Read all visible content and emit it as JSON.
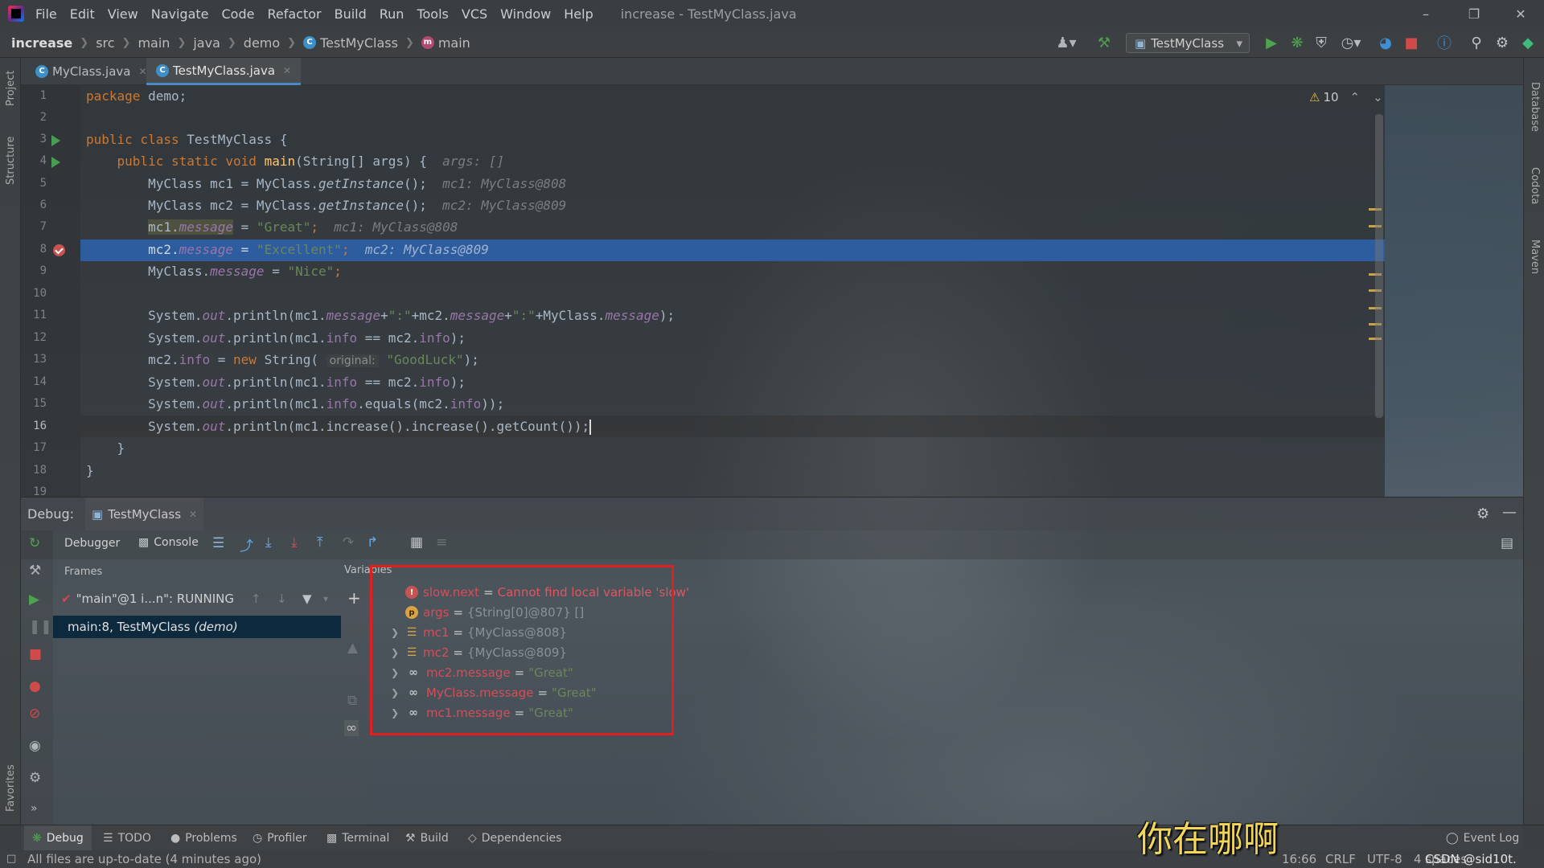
{
  "menu": {
    "items": [
      "File",
      "Edit",
      "View",
      "Navigate",
      "Code",
      "Refactor",
      "Build",
      "Run",
      "Tools",
      "VCS",
      "Window",
      "Help"
    ],
    "window_title": "increase - TestMyClass.java"
  },
  "breadcrumb": {
    "project": "increase",
    "path": [
      "src",
      "main",
      "java",
      "demo"
    ],
    "class_name": "TestMyClass",
    "method_name": "main"
  },
  "toolbar": {
    "run_config": "TestMyClass"
  },
  "left_strip": {
    "project": "Project",
    "structure": "Structure",
    "favorites": "Favorites"
  },
  "right_strip": {
    "database": "Database",
    "codota": "Codota",
    "maven": "Maven"
  },
  "tabs": [
    {
      "label": "MyClass.java"
    },
    {
      "label": "TestMyClass.java"
    }
  ],
  "editor": {
    "warnings": "10",
    "line_numbers": [
      "1",
      "2",
      "3",
      "4",
      "5",
      "6",
      "7",
      "8",
      "9",
      "10",
      "11",
      "12",
      "13",
      "14",
      "15",
      "16",
      "17",
      "18",
      "19"
    ],
    "code": {
      "l1_kw": "package",
      "l1_rest": " demo;",
      "l3_kw": "public class",
      "l3_rest": " TestMyClass {",
      "l4_kw": "public static void",
      "l4_fn": "main",
      "l4_rest": "(String[] args) {",
      "l4_hint": "args: []",
      "l5_a": "MyClass mc1 = MyClass.",
      "l5_m": "getInstance",
      "l5_b": "();",
      "l5_hint": "mc1: MyClass@808",
      "l6_a": "MyClass mc2 = MyClass.",
      "l6_m": "getInstance",
      "l6_b": "();",
      "l6_hint": "mc2: MyClass@809",
      "l7_a": "mc1.",
      "l7_f": "message",
      "l7_b": " = ",
      "l7_s": "\"Great\"",
      "l7_c": ";",
      "l7_hint": "mc1: MyClass@808",
      "l8_a": "mc2.",
      "l8_f": "message",
      "l8_b": " = ",
      "l8_s": "\"Excellent\"",
      "l8_c": ";",
      "l8_hint": "mc2: MyClass@809",
      "l9_a": "MyClass.",
      "l9_f": "message",
      "l9_b": " = ",
      "l9_s": "\"Nice\"",
      "l9_c": ";",
      "l11_a": "System.",
      "l11_out": "out",
      "l11_b": ".println(mc1.",
      "l11_f1": "message",
      "l11_c": "+",
      "l11_s1": "\":\"",
      "l11_d": "+mc2.",
      "l11_f2": "message",
      "l11_e": "+",
      "l11_s2": "\":\"",
      "l11_g": "+MyClass.",
      "l11_f3": "message",
      "l11_h": ");",
      "l12_a": "System.",
      "l12_out": "out",
      "l12_b": ".println(mc1.",
      "l12_f1": "info",
      "l12_c": " == mc2.",
      "l12_f2": "info",
      "l12_d": ");",
      "l13_a": "mc2.",
      "l13_f": "info",
      "l13_b": " = ",
      "l13_kw": "new",
      "l13_c": " String(",
      "l13_hint": "original:",
      "l13_s": "\"GoodLuck\"",
      "l13_d": ");",
      "l14_a": "System.",
      "l14_out": "out",
      "l14_b": ".println(mc1.",
      "l14_f1": "info",
      "l14_c": " == mc2.",
      "l14_f2": "info",
      "l14_d": ");",
      "l15_a": "System.",
      "l15_out": "out",
      "l15_b": ".println(mc1.",
      "l15_f1": "info",
      "l15_c": ".equals(mc2.",
      "l15_f2": "info",
      "l15_d": "));",
      "l16_a": "System.",
      "l16_out": "out",
      "l16_b": ".println(mc1.increase().increase().getCount());",
      "l17": "}",
      "l18": "}"
    }
  },
  "debug": {
    "label": "Debug:",
    "session": "TestMyClass",
    "tab_debugger": "Debugger",
    "tab_console": "Console",
    "frames_header": "Frames",
    "variables_header": "Variables",
    "thread": "\"main\"@1 i...n\": RUNNING",
    "frame_method": "main:8, TestMyClass",
    "frame_pkg": "(demo)",
    "variables": [
      {
        "name": "slow.next",
        "value": "Cannot find local variable 'slow'"
      },
      {
        "name": "args",
        "value": "{String[0]@807} []"
      },
      {
        "name": "mc1",
        "value": "{MyClass@808}"
      },
      {
        "name": "mc2",
        "value": "{MyClass@809}"
      },
      {
        "name": "mc2.message",
        "value": "\"Great\""
      },
      {
        "name": "MyClass.message",
        "value": "\"Great\""
      },
      {
        "name": "mc1.message",
        "value": "\"Great\""
      }
    ]
  },
  "bottom_tabs": [
    "Debug",
    "TODO",
    "Problems",
    "Profiler",
    "Terminal",
    "Build",
    "Dependencies"
  ],
  "event_log": "Event Log",
  "status": {
    "message": "All files are up-to-date (4 minutes ago)",
    "position": "16:66",
    "line_sep": "CRLF",
    "encoding": "UTF-8",
    "indent": "4 spaces",
    "watermark": "CSDN @sid10t."
  },
  "subtitle": "你在哪啊"
}
